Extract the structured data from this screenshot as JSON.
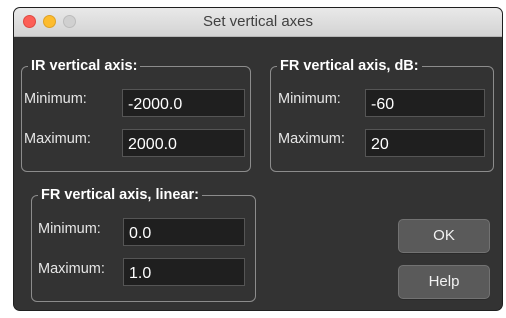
{
  "window": {
    "title": "Set vertical axes"
  },
  "ir_axis": {
    "legend": "IR vertical axis:",
    "min_label": "Minimum:",
    "min_value": "-2000.0",
    "max_label": "Maximum:",
    "max_value": "2000.0"
  },
  "fr_db_axis": {
    "legend": "FR vertical axis, dB:",
    "min_label": "Minimum:",
    "min_value": "-60",
    "max_label": "Maximum:",
    "max_value": "20"
  },
  "fr_linear_axis": {
    "legend": "FR vertical axis, linear:",
    "min_label": "Minimum:",
    "min_value": "0.0",
    "max_label": "Maximum:",
    "max_value": "1.0"
  },
  "buttons": {
    "ok": "OK",
    "help": "Help"
  },
  "colors": {
    "close": "#fc5f57",
    "minimize": "#fdbc2e",
    "zoom": "#d0d0d0",
    "background": "#333333"
  }
}
